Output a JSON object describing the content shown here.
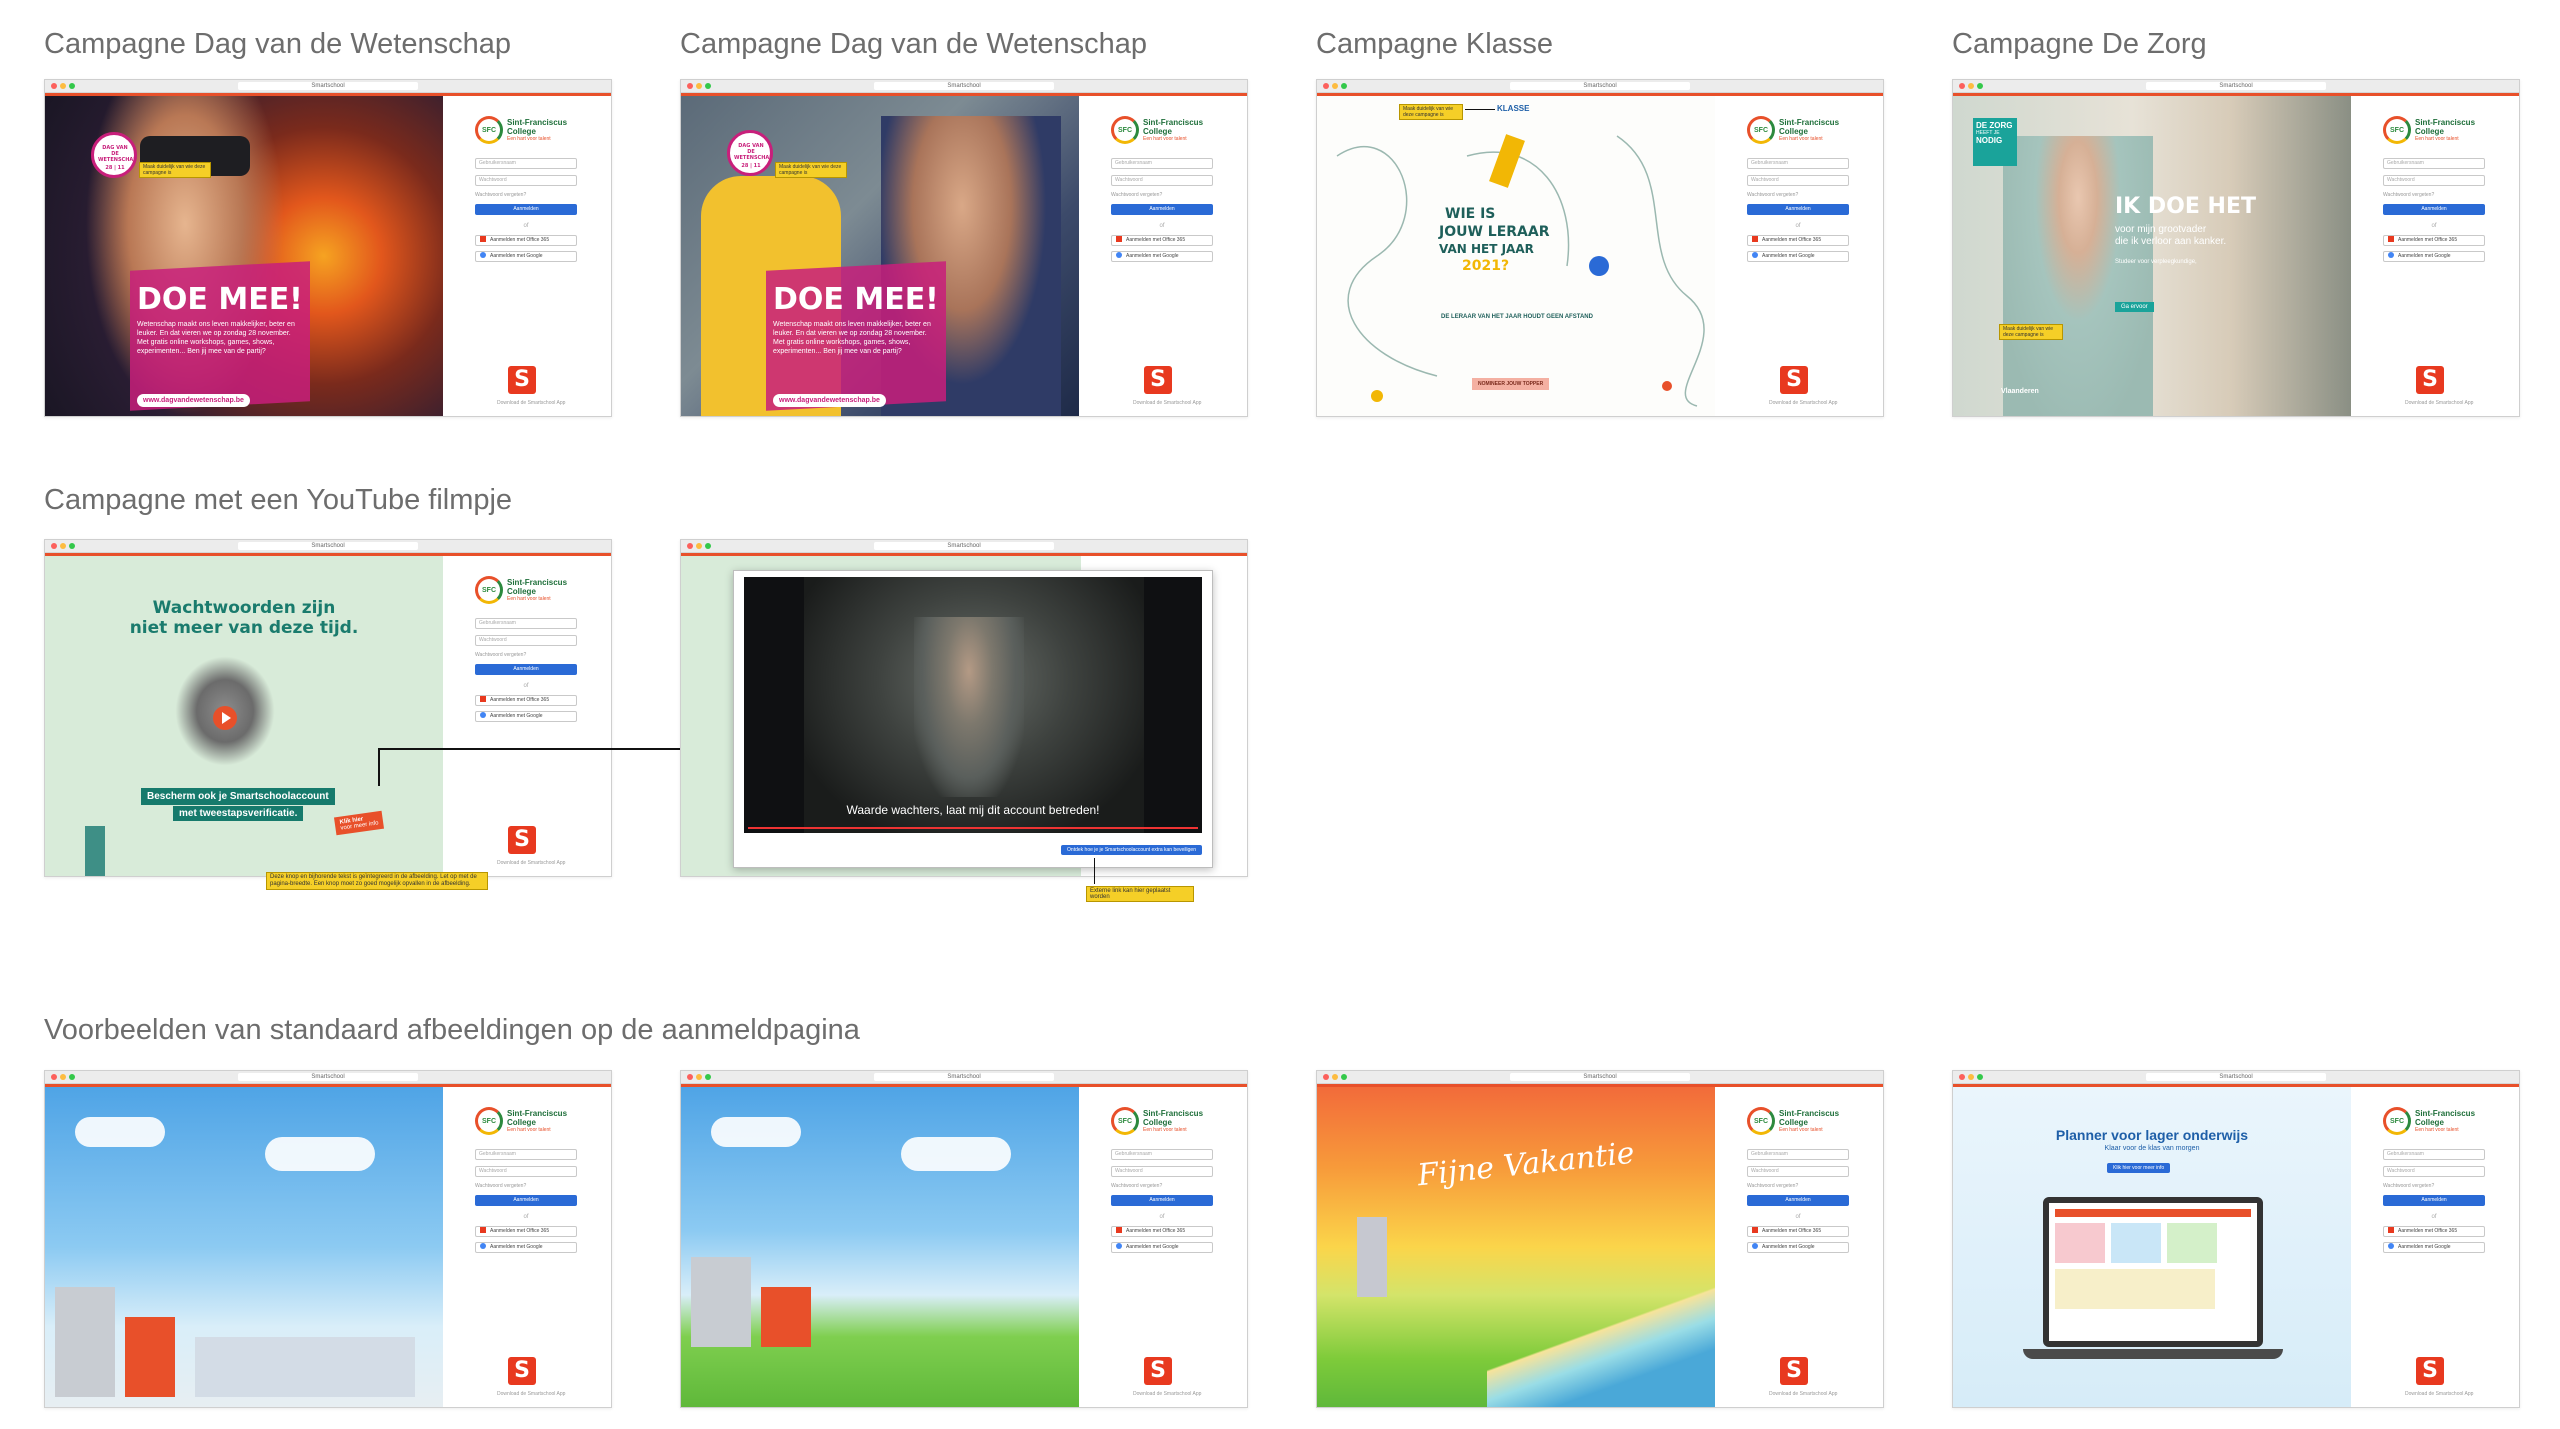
{
  "sections": {
    "s1": "Campagne Dag van de Wetenschap",
    "s2": "Campagne Dag van de Wetenschap",
    "s3": "Campagne Klasse",
    "s4": "Campagne De Zorg",
    "s5": "Campagne met een YouTube filmpje",
    "s6": "Voorbeelden van standaard afbeeldingen op de aanmeldpagina"
  },
  "browser": {
    "title": "Smartschool"
  },
  "login": {
    "school_line1": "Sint-Franciscus",
    "school_line2": "College",
    "school_tagline": "Een hart voor talent",
    "logo_initials": "SFC",
    "username_placeholder": "Gebruikersnaam",
    "password_placeholder": "Wachtwoord",
    "remember": "Wachtwoord vergeten?",
    "login_button": "Aanmelden",
    "or": "of",
    "office_button": "Aanmelden met Office 365",
    "google_button": "Aanmelden met Google",
    "app_download": "Download de Smartschool App",
    "brand_letter": "S"
  },
  "campaigns": {
    "wetenschap": {
      "badge": "DAG VAN DE WETENSCHAP",
      "badge_date": "28 | 11",
      "title": "DOE MEE!",
      "body": "Wetenschap maakt ons leven makkelijker, beter en leuker. En dat vieren we op zondag 28 november. Met gratis online workshops, games, shows, experimenten... Ben jij mee van de partij?",
      "url": "www.dagvandewetenschap.be",
      "note": "Maak duidelijk van wie deze campagne is"
    },
    "klasse": {
      "note": "Maak duidelijk van wie deze campagne is",
      "brand": "KLASSE",
      "title_l1": "WIE IS",
      "title_l2": "JOUW LERAAR",
      "title_l3": "VAN HET JAAR",
      "title_l4": "2021?",
      "subtitle": "DE LERAAR VAN HET JAAR HOUDT GEEN AFSTAND",
      "button": "NOMINEER JOUW TOPPER"
    },
    "zorg": {
      "logo_l1": "DE ZORG",
      "logo_l2": "HEEFT JE",
      "logo_l3": "NODIG",
      "title": "IK DOE HET",
      "sub_l1": "voor mijn grootvader",
      "sub_l2": "die ik verloor aan kanker.",
      "sub_l3": "Studeer voor verpleegkundige,",
      "button": "Ga ervoor",
      "note": "Maak duidelijk van wie deze campagne is",
      "footer": "Vlaanderen"
    },
    "youtube": {
      "title_l1": "Wachtwoorden zijn",
      "title_l2": "niet meer van deze tijd.",
      "band_l1": "Bescherm ook je Smartschoolaccount",
      "band_l2": "met tweestapsverificatie.",
      "tag_l1": "Klik hier",
      "tag_l2": "voor meer info",
      "note_bottom": "Deze knop en bijhorende tekst is geïntegreerd in de afbeelding. Let op met de pagina-breedte. Een knop moet zo goed mogelijk opvallen in de afbeelding.",
      "caption": "Waarde wachters, laat mij dit account betreden!",
      "video_button": "Ontdek hoe je je Smartschoolaccount extra kan beveiligen",
      "note_video": "Externe link kan hier geplaatst worden"
    },
    "standard": {
      "vakantie": "Fijne Vakantie",
      "planner_title": "Planner voor lager onderwijs",
      "planner_sub": "Klaar voor de klas van morgen",
      "planner_btn": "Klik hier voor meer info"
    }
  },
  "colors": {
    "accent": "#e8502a",
    "login_blue": "#2a6ad6",
    "magenta": "#c81f7b",
    "note_yellow": "#f5cf27"
  }
}
